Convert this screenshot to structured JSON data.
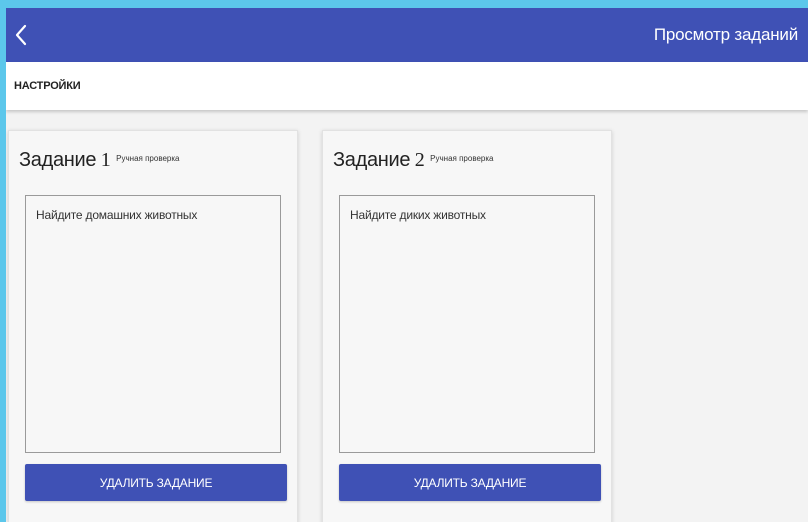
{
  "appbar": {
    "back_icon": "chevron-left-icon",
    "title": "Просмотр заданий"
  },
  "subbar": {
    "tab_label": "НАСТРОЙКИ"
  },
  "tasks": [
    {
      "title": "Задание",
      "number": "1",
      "check_type": "Ручная проверка",
      "text": "Найдите домашних животных",
      "delete_label": "УДАЛИТЬ ЗАДАНИЕ"
    },
    {
      "title": "Задание",
      "number": "2",
      "check_type": "Ручная проверка",
      "text": "Найдите диких животных",
      "delete_label": "УДАЛИТЬ ЗАДАНИЕ"
    }
  ],
  "colors": {
    "primary": "#3f51b5",
    "frame": "#5cc7eb",
    "background": "#f3f3f3"
  }
}
